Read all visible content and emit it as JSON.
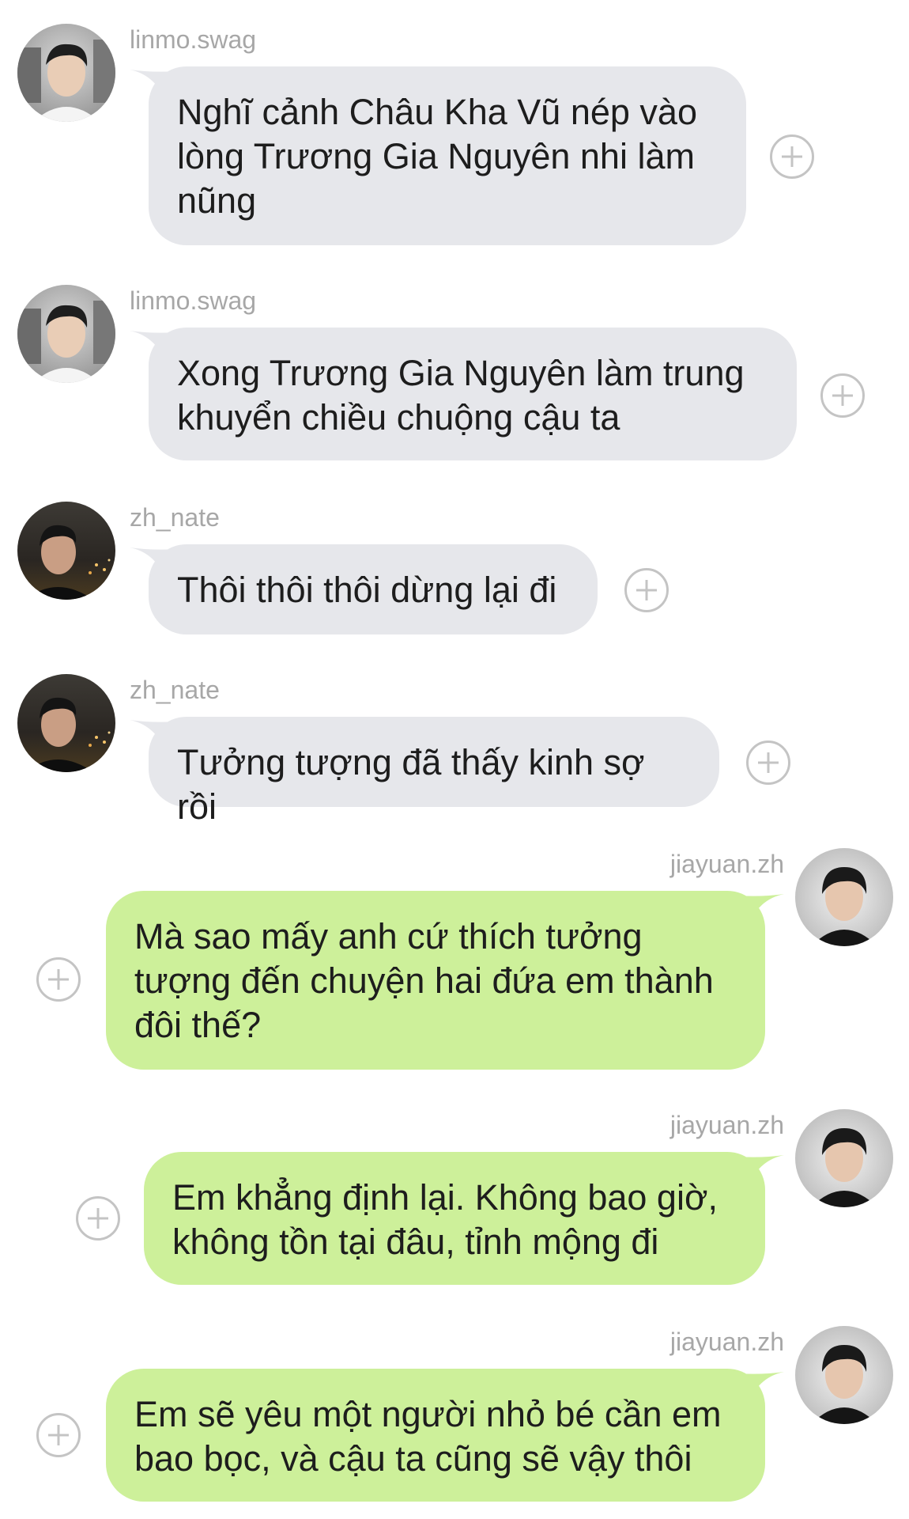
{
  "messages": [
    {
      "username": "linmo.swag",
      "text": "Nghĩ cảnh Châu Kha Vũ nép vào lòng Trương Gia Nguyên nhi làm nũng",
      "direction": "incoming",
      "avatar": "avatar-linmo"
    },
    {
      "username": "linmo.swag",
      "text": "Xong Trương Gia Nguyên làm trung khuyển chiều chuộng cậu ta",
      "direction": "incoming",
      "avatar": "avatar-linmo"
    },
    {
      "username": "zh_nate",
      "text": "Thôi thôi thôi dừng lại đi",
      "direction": "incoming",
      "avatar": "avatar-nate"
    },
    {
      "username": "zh_nate",
      "text": "Tưởng tượng đã thấy kinh sợ rồi",
      "direction": "incoming",
      "avatar": "avatar-nate"
    },
    {
      "username": "jiayuan.zh",
      "text": "Mà sao mấy anh cứ thích tưởng tượng đến chuyện hai đứa em thành đôi thế?",
      "direction": "outgoing",
      "avatar": "avatar-jiayuan"
    },
    {
      "username": "jiayuan.zh",
      "text": "Em khẳng định lại. Không bao giờ, không tồn tại đâu, tỉnh mộng đi",
      "direction": "outgoing",
      "avatar": "avatar-jiayuan"
    },
    {
      "username": "jiayuan.zh",
      "text": "Em sẽ yêu một người nhỏ bé cần em bao bọc, và cậu ta cũng sẽ vậy thôi",
      "direction": "outgoing",
      "avatar": "avatar-jiayuan"
    }
  ],
  "colors": {
    "incoming_bubble": "#e6e7eb",
    "outgoing_bubble": "#cdf09a",
    "username": "#a7a7a7",
    "text": "#1d1d1d",
    "plus_icon": "#c4c4c4"
  }
}
